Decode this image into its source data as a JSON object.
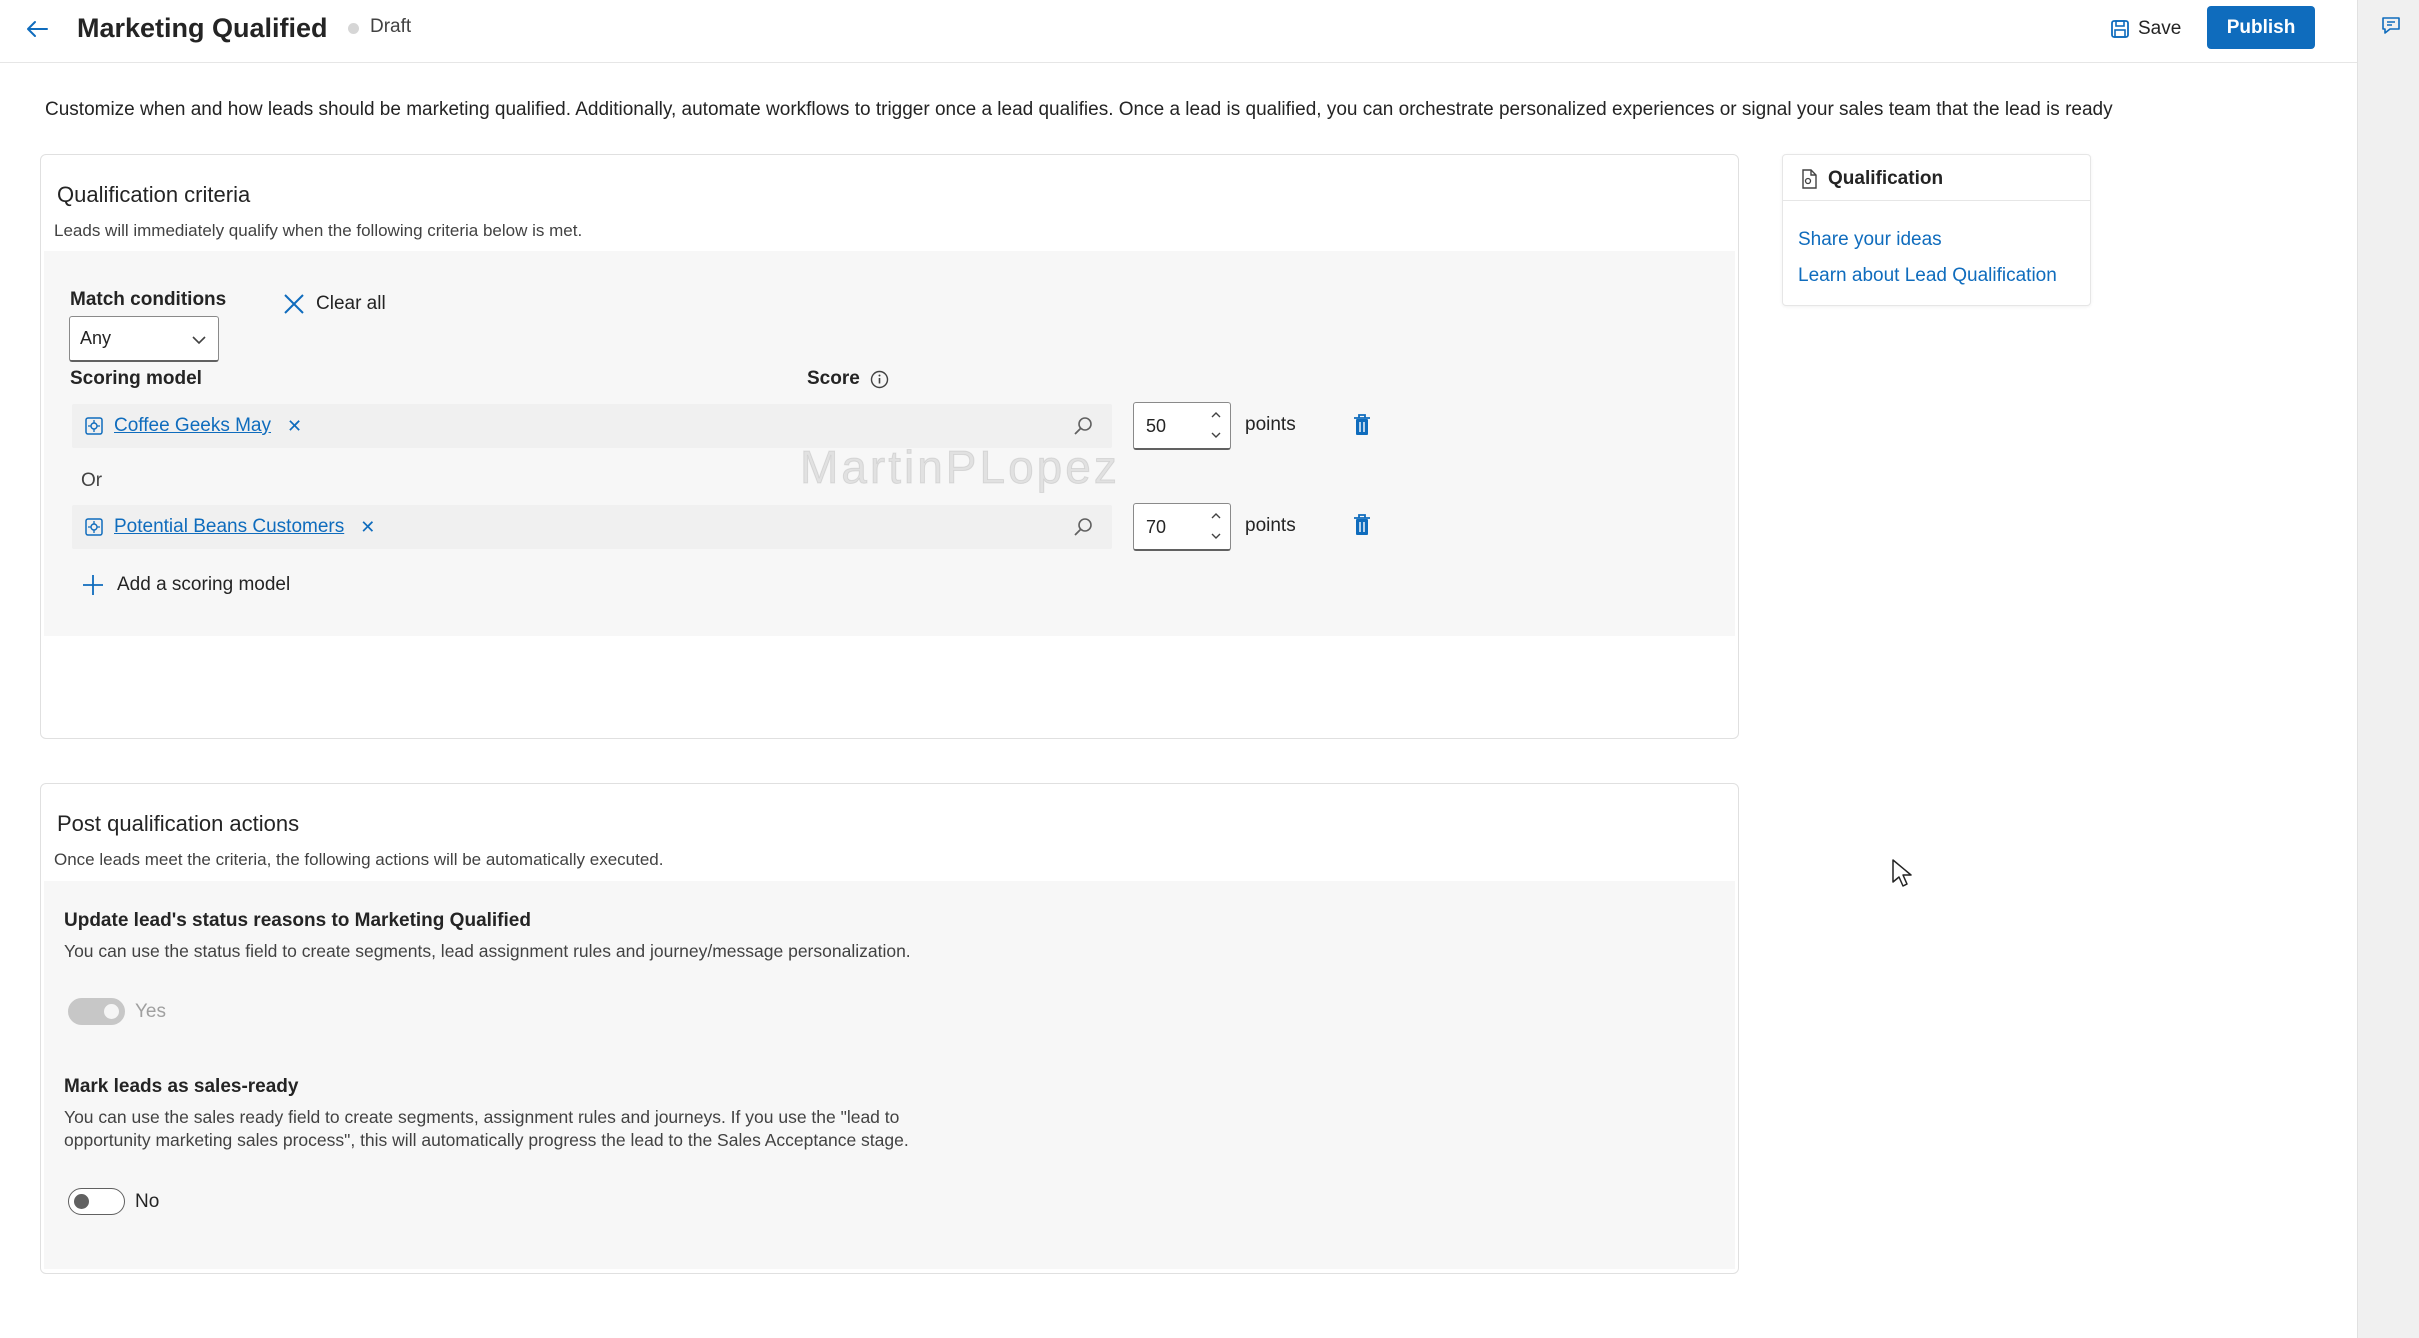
{
  "header": {
    "title": "Marketing Qualified",
    "status": "Draft",
    "save_label": "Save",
    "publish_label": "Publish"
  },
  "description": "Customize when and how leads should be marketing qualified. Additionally, automate workflows to trigger once a lead qualifies. Once a lead is qualified, you can orchestrate personalized experiences or signal your sales team that the lead is ready",
  "qualification": {
    "title": "Qualification criteria",
    "subtitle": "Leads will immediately qualify when the following criteria below is met.",
    "match_conditions_label": "Match conditions",
    "match_conditions_value": "Any",
    "clear_all_label": "Clear all",
    "scoring_model_header": "Scoring model",
    "score_header": "Score",
    "or_label": "Or",
    "add_model_label": "Add a scoring model",
    "models": [
      {
        "name": "Coffee Geeks May",
        "score": "50",
        "unit": "points"
      },
      {
        "name": "Potential Beans Customers",
        "score": "70",
        "unit": "points"
      }
    ],
    "watermark": "MartinPLopez"
  },
  "side_panel": {
    "title": "Qualification",
    "links": [
      "Share your ideas",
      "Learn about Lead Qualification"
    ]
  },
  "post_actions": {
    "title": "Post qualification actions",
    "subtitle": "Once leads meet the criteria, the following actions will be automatically executed.",
    "status_heading": "Update lead's status reasons to Marketing Qualified",
    "status_text": "You can use the status field to create segments, lead assignment rules and journey/message personalization.",
    "status_toggle_label": "Yes",
    "sales_ready_heading": "Mark leads as sales-ready",
    "sales_ready_text_1": "You can use the sales ready field to create segments, assignment rules and journeys. If you use the \"lead to",
    "sales_ready_text_2": "opportunity marketing sales process\", this will automatically progress the lead to the Sales Acceptance stage.",
    "sales_ready_toggle_label": "No"
  },
  "colors": {
    "accent": "#0f6cbd",
    "text": "#242424",
    "trash": "#0f6cbd"
  }
}
